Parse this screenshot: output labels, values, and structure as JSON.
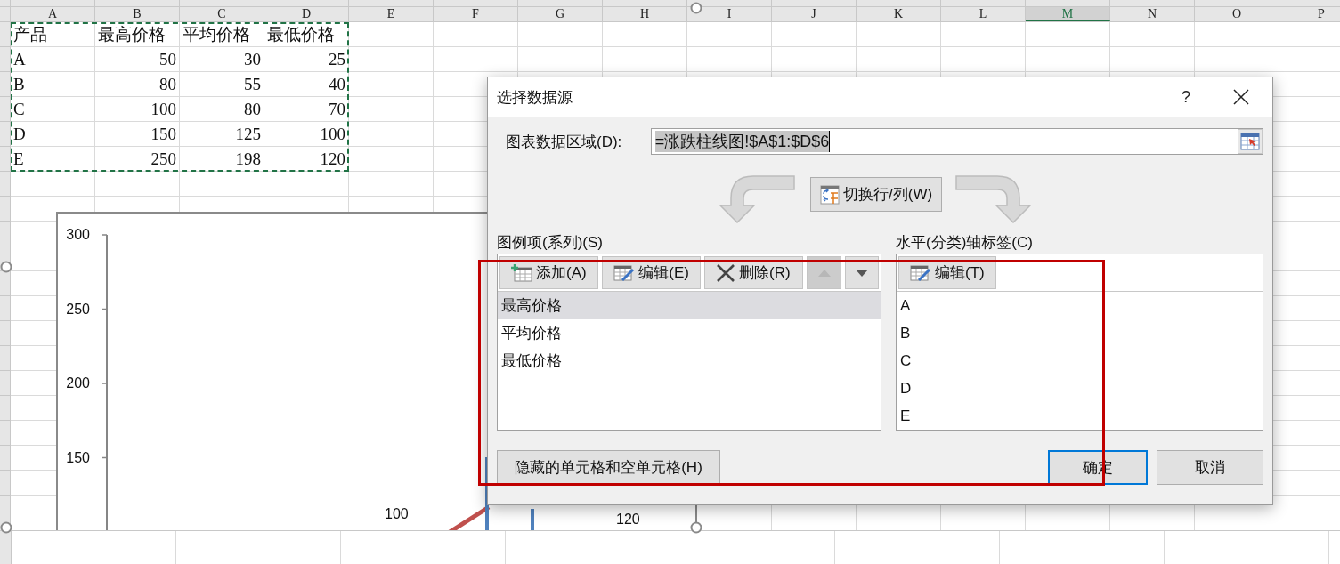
{
  "sheet": {
    "column_headers": [
      {
        "label": "A",
        "selected": false
      },
      {
        "label": "B",
        "selected": false
      },
      {
        "label": "C",
        "selected": false
      },
      {
        "label": "D",
        "selected": false
      },
      {
        "label": "E",
        "selected": false
      },
      {
        "label": "F",
        "selected": false
      },
      {
        "label": "G",
        "selected": false
      },
      {
        "label": "H",
        "selected": false
      },
      {
        "label": "I",
        "selected": false
      },
      {
        "label": "J",
        "selected": false
      },
      {
        "label": "K",
        "selected": false
      },
      {
        "label": "L",
        "selected": false
      },
      {
        "label": "M",
        "selected": true
      },
      {
        "label": "N",
        "selected": false
      },
      {
        "label": "O",
        "selected": false
      },
      {
        "label": "P",
        "selected": false
      }
    ],
    "cells": [
      [
        "产品",
        "最高价格",
        "平均价格",
        "最低价格"
      ],
      [
        "A",
        "50",
        "30",
        "25"
      ],
      [
        "B",
        "80",
        "55",
        "40"
      ],
      [
        "C",
        "100",
        "80",
        "70"
      ],
      [
        "D",
        "150",
        "125",
        "100"
      ],
      [
        "E",
        "250",
        "198",
        "120"
      ]
    ]
  },
  "chart": {
    "y_ticks": [
      "300",
      "250",
      "200",
      "150"
    ],
    "data_labels": [
      "100",
      "120"
    ]
  },
  "dialog": {
    "title": "选择数据源",
    "help": "?",
    "range_label": "图表数据区域(D):",
    "range_value": "=涨跌柱线图!$A$1:$D$6",
    "switch_button": "切换行/列(W)",
    "series_panel": {
      "label": "图例项(系列)(S)",
      "buttons": [
        {
          "kind": "add",
          "label": "添加(A)",
          "disabled": false
        },
        {
          "kind": "edit",
          "label": "编辑(E)",
          "disabled": false
        },
        {
          "kind": "delete",
          "label": "删除(R)",
          "disabled": false
        },
        {
          "kind": "up",
          "disabled": true
        },
        {
          "kind": "down",
          "disabled": false
        }
      ],
      "items": [
        {
          "label": "最高价格",
          "selected": true
        },
        {
          "label": "平均价格",
          "selected": false
        },
        {
          "label": "最低价格",
          "selected": false
        }
      ]
    },
    "axis_panel": {
      "label": "水平(分类)轴标签(C)",
      "edit_button": "编辑(T)",
      "items": [
        "A",
        "B",
        "C",
        "D",
        "E"
      ]
    },
    "hidden_cells_button": "隐藏的单元格和空单元格(H)",
    "ok_button": "确定",
    "cancel_button": "取消"
  }
}
